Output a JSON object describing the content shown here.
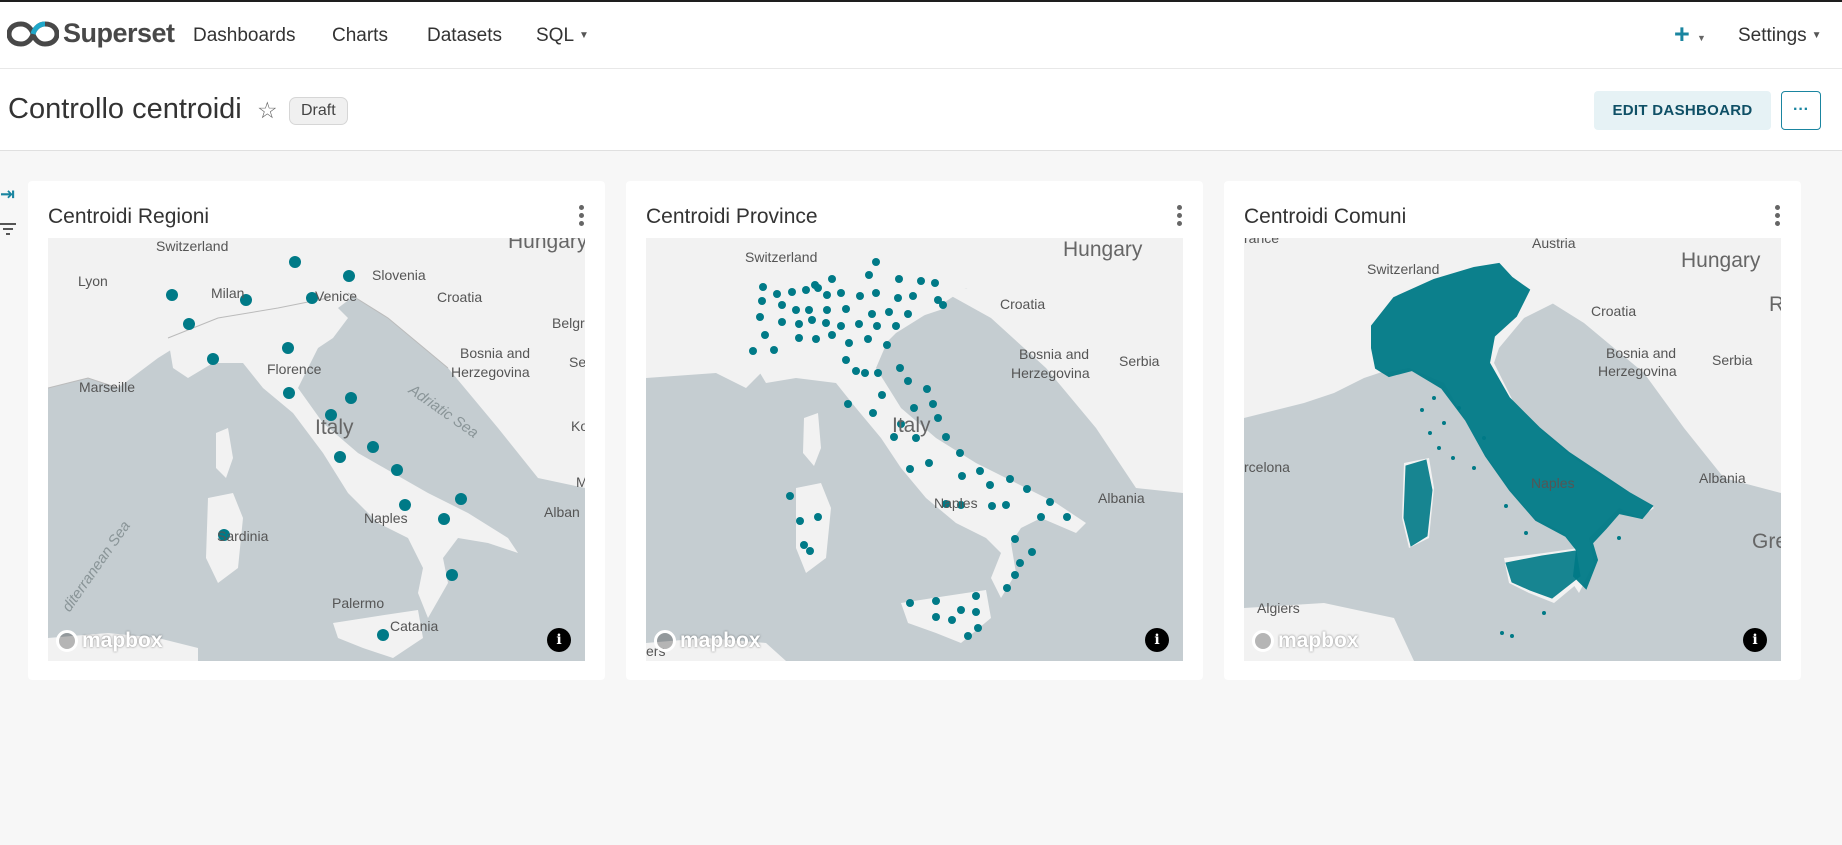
{
  "navbar": {
    "brand": "Superset",
    "items": [
      {
        "label": "Dashboards"
      },
      {
        "label": "Charts"
      },
      {
        "label": "Datasets"
      },
      {
        "label": "SQL"
      }
    ],
    "plus_label": "+",
    "settings_label": "Settings"
  },
  "header": {
    "title": "Controllo centroidi",
    "status_badge": "Draft",
    "edit_button": "EDIT DASHBOARD",
    "more_button": "···"
  },
  "colors": {
    "accent": "#1a85a0",
    "marker": "#007a87",
    "land": "#f2f2f2",
    "sea": "#c5cdd1"
  },
  "charts": [
    {
      "title": "Centroidi Regioni",
      "attribution": "mapbox",
      "labels": [
        "Switzerland",
        "Hungary",
        "Lyon",
        "Milan",
        "Slovenia",
        "Venice",
        "Croatia",
        "Belgr",
        "Marseille",
        "Florence",
        "Bosnia and",
        "Herzegovina",
        "Se",
        "Italy",
        "Adriatic Sea",
        "Ko",
        "Sardinia",
        "Naples",
        "Alban",
        "M",
        "diterranean Sea",
        "Palermo",
        "Catania"
      ]
    },
    {
      "title": "Centroidi Province",
      "attribution": "mapbox",
      "labels": [
        "Switzerland",
        "Hungary",
        "Croatia",
        "Bosnia and",
        "Herzegovina",
        "Serbia",
        "Italy",
        "Naples",
        "Albania",
        "ers"
      ]
    },
    {
      "title": "Centroidi Comuni",
      "attribution": "mapbox",
      "labels": [
        "rance",
        "Austria",
        "Hungary",
        "Switzerland",
        "Croatia",
        "R",
        "Bosnia and",
        "Herzegovina",
        "Serbia",
        "rcelona",
        "Naples",
        "Albania",
        "Gre",
        "Algiers"
      ]
    }
  ]
}
